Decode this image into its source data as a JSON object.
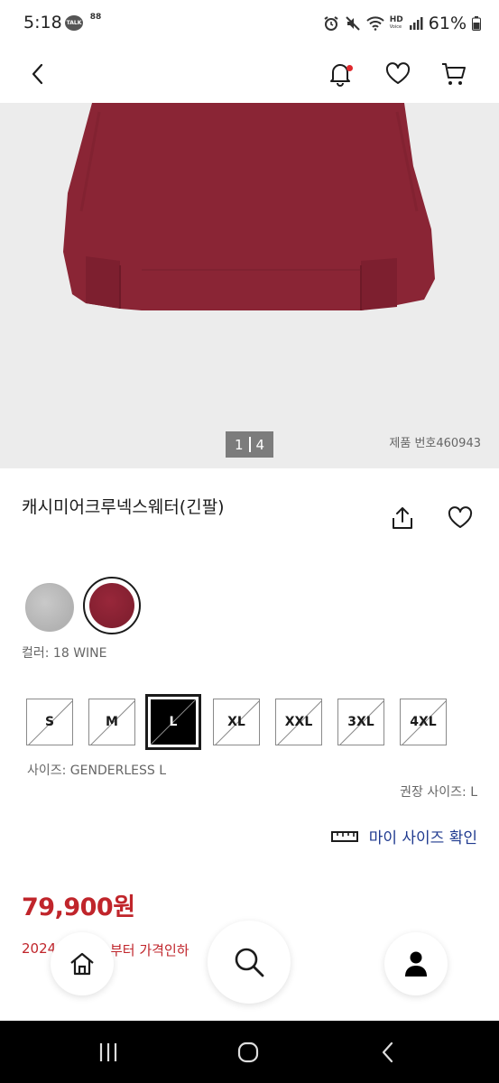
{
  "status_bar": {
    "time": "5:18",
    "talk_badge": "TALK",
    "grid_badge": "88",
    "battery_text": "61%",
    "hd_label": "HD",
    "voice_label": "Voice"
  },
  "header": {
    "back_icon": "chevron-left-icon",
    "notification_icon": "bell-icon",
    "wishlist_icon": "heart-icon",
    "cart_icon": "cart-icon",
    "notification_dot_color": "#e0282d"
  },
  "gallery": {
    "current": "1",
    "total": "4",
    "product_number": "제품 번호460943"
  },
  "product": {
    "name": "캐시미어크루넥스웨터(긴팔)",
    "share_icon": "share-icon",
    "favorite_icon": "heart-icon"
  },
  "colors": {
    "swatches": [
      {
        "name": "gray",
        "color": "#b9b9b9"
      },
      {
        "name": "wine",
        "color": "#8c2233",
        "selected": true
      }
    ],
    "label": "컬러: 18 WINE"
  },
  "sizes": {
    "options": [
      {
        "label": "S",
        "available": false
      },
      {
        "label": "M",
        "available": false
      },
      {
        "label": "L",
        "available": false,
        "selected": true
      },
      {
        "label": "XL",
        "available": false
      },
      {
        "label": "XXL",
        "available": false
      },
      {
        "label": "3XL",
        "available": false
      },
      {
        "label": "4XL",
        "available": false
      }
    ],
    "label": "사이즈: GENDERLESS L",
    "recommended": "권장 사이즈: L",
    "my_size_link": "마이 사이즈 확인",
    "ruler_icon": "ruler-icon"
  },
  "price": {
    "value": "79,900원",
    "note_start": "2024",
    "note_end": "부터 가격인하",
    "color": "#c0252b"
  },
  "floating_nav": {
    "home_icon": "home-icon",
    "search_icon": "search-icon",
    "profile_icon": "user-icon"
  },
  "system_nav": {
    "recents_icon": "recents-icon",
    "home_icon": "home-circle-icon",
    "back_icon": "back-chevron-icon"
  }
}
